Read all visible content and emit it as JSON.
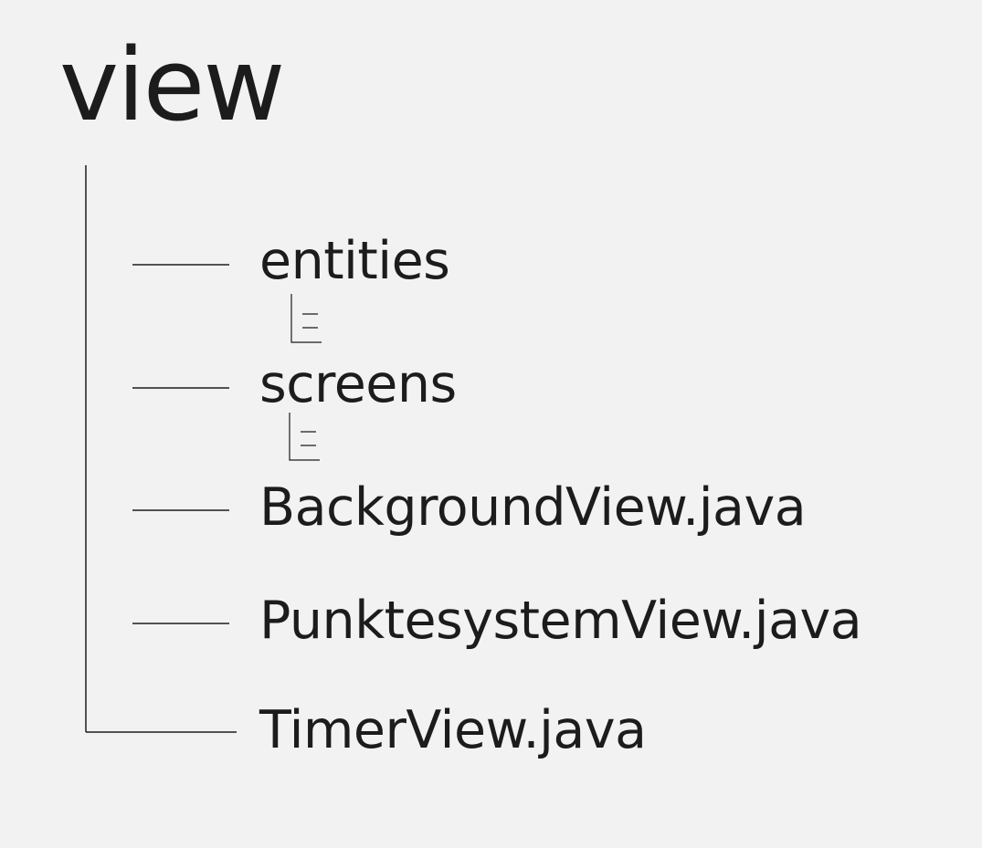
{
  "tree": {
    "root": {
      "label": "view"
    },
    "items": [
      {
        "label": "entities",
        "collapsed_icon": "collapsed-children-icon"
      },
      {
        "label": "screens",
        "collapsed_icon": "collapsed-children-icon"
      },
      {
        "label": "BackgroundView.java"
      },
      {
        "label": "PunktesystemView.java"
      },
      {
        "label": "TimerView.java"
      }
    ]
  },
  "colors": {
    "background": "#f2f2f2",
    "text": "#1c1c1c",
    "line": "#1c1c1c"
  }
}
